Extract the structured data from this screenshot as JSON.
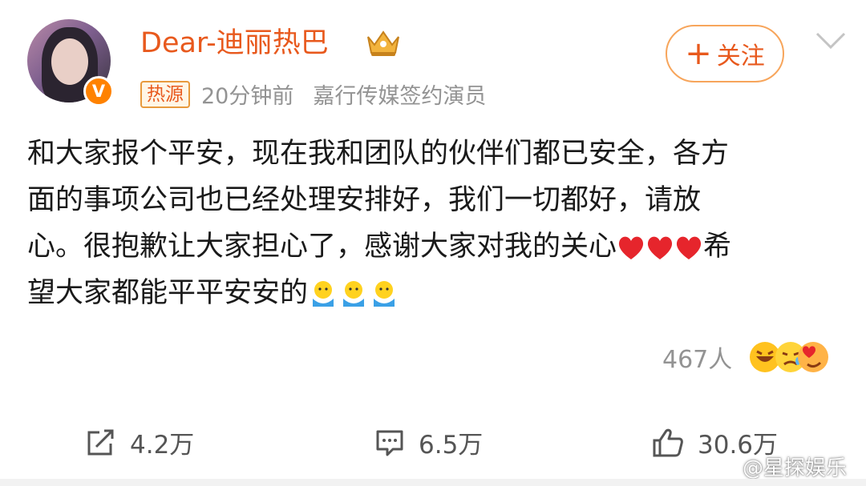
{
  "user": {
    "name": "Dear-迪丽热巴",
    "verified_badge": "V",
    "avatar": "avatar-photo",
    "crown_icon": "crown-icon"
  },
  "meta": {
    "tag": "热源",
    "time": "20分钟前",
    "source": "嘉行传媒签约演员"
  },
  "follow_button": {
    "icon": "+",
    "label": "关注"
  },
  "post": {
    "lines": [
      "和大家报个平安，现在我和团队的伙伴们都已安全，各方",
      "面的事项公司也已经处理安排好，我们一切都好，请放",
      "心。很抱歉让大家担心了，感谢大家对我的关心",
      "希",
      "望大家都能平平安安的"
    ]
  },
  "reactions": {
    "count": "467人"
  },
  "actions": {
    "repost": "4.2万",
    "comment": "6.5万",
    "like": "30.6万"
  },
  "watermark": "@星探娱乐",
  "colors": {
    "accent": "#e8591d",
    "muted": "#939393",
    "heart": "#e6252c"
  }
}
